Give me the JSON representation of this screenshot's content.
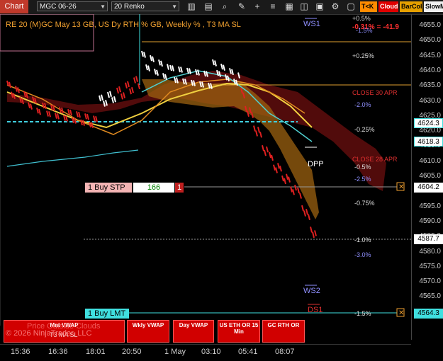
{
  "toolbar": {
    "chart_tab": "Chart",
    "instrument": "MGC 06-26",
    "bar_type": "20 Renko",
    "buttons": [
      "T<K",
      "Cloud",
      "BarCol",
      "SlowM"
    ]
  },
  "header": {
    "title": "RE 20  (M)GC May 13 GB, US Dy RTH % GB, Weekly % , T3 MA SL",
    "pct_top": "+0.5%",
    "pnl": "-0.31% = -41.9",
    "pct_minus": "-1.5%"
  },
  "levels": {
    "ws1": "WS1",
    "dpp": "DPP",
    "ws2": "WS2",
    "ds1": "DS1",
    "pct_p025": "+0.25%",
    "close_30": "CLOSE 30 APR",
    "pct_m20a": "-2.0%",
    "pct_m025": "-0.25%",
    "close_28": "CLOSE 28 APR",
    "pct_m05": "-0.5%",
    "pct_m25": "-2.5%",
    "pct_m075": "-0.75%",
    "pct_m10": "-1.0%",
    "pct_m30": "-3.0%",
    "pct_m15": "-1.5%"
  },
  "orders": {
    "buy_stp": "1 Buy STP",
    "buy_stp_qty": "166",
    "buy_stp_count": "1",
    "buy_lmt": "1 Buy LMT"
  },
  "price_axis": {
    "ticks": [
      "4655.0",
      "4650.0",
      "4645.0",
      "4640.0",
      "4635.0",
      "4630.0",
      "4625.0",
      "4620.0",
      "4615.0",
      "4610.0",
      "4605.0",
      "4600.0",
      "4595.0",
      "4590.0",
      "4585.0",
      "4580.0",
      "4575.0",
      "4570.0",
      "4565.0",
      "4560.0"
    ],
    "boxes": {
      "p4624": "4624.3",
      "p4618": "4618.3",
      "p4604": "4604.2",
      "p4587": "4587.7",
      "p4564": "4564.3"
    }
  },
  "time_axis": [
    "15:36",
    "16:36",
    "18:01",
    "20:50",
    "1 May",
    "03:10",
    "05:41",
    "08:07"
  ],
  "bottom_buttons": [
    {
      "label": "Mnt VWAP"
    },
    {
      "label": "Wkly VWAP"
    },
    {
      "label": "Day VWAP"
    },
    {
      "label": "US ETH OR 15 Min"
    },
    {
      "label": "GC RTH OR"
    }
  ],
  "watermark": {
    "line1": "Price Outside Clouds",
    "line2": "T3 MA SL",
    "copyright": "© 2026 NinjaTrader, LLC"
  },
  "colors": {
    "accent_red": "#c0392b",
    "renko_red": "#e02020",
    "renko_white": "#ffffff",
    "cyan": "#40e0e0",
    "orange_cloud": "#b07010",
    "dark_red_cloud": "#6a0d0d"
  }
}
